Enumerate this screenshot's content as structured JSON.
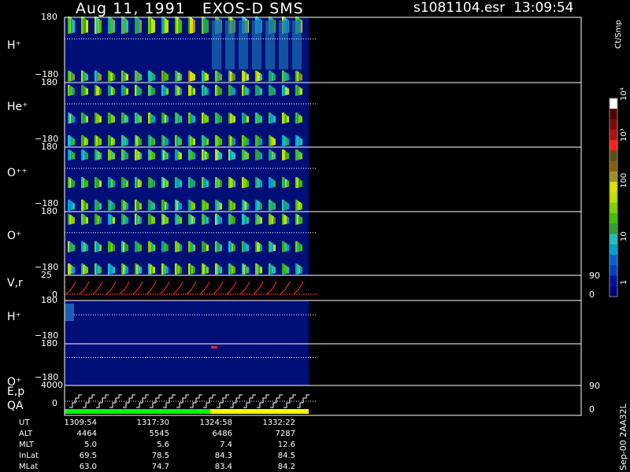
{
  "header": {
    "title": "Aug 11, 1991   EXOS-D SMS",
    "file": "s1081104.esr",
    "time": "13:09:54"
  },
  "colorbar": {
    "unit": "Ct/Smp",
    "tick_labels": [
      "1",
      "10",
      "100",
      "10³",
      "10⁴"
    ],
    "colors": [
      "#000080",
      "#0010a0",
      "#0040c0",
      "#0060d0",
      "#00a0d0",
      "#20c0c0",
      "#30a030",
      "#40c000",
      "#80d000",
      "#c0e000",
      "#e0e000",
      "#a09020",
      "#806010",
      "#605010",
      "#ff2020",
      "#b01010",
      "#800808",
      "#500404",
      "#ffffff"
    ]
  },
  "panels": [
    {
      "label": "H⁺",
      "tick_top": "180",
      "tick_bottom": "−180"
    },
    {
      "label": "He⁺",
      "tick_top": "180",
      "tick_bottom": "−180"
    },
    {
      "label": "O⁺⁺",
      "tick_top": "180",
      "tick_bottom": "−180"
    },
    {
      "label": "O⁺",
      "tick_top": "180",
      "tick_bottom": "−180"
    },
    {
      "label": "V,r",
      "tick_top": "25",
      "tick_mid": "0",
      "right_top": "90",
      "right_bottom": "0"
    },
    {
      "label": "H⁺",
      "tick_top": "180",
      "tick_bottom": "−180"
    },
    {
      "label": "O⁺",
      "tick_top": "180",
      "tick_bottom": "−180"
    },
    {
      "label": "E,p",
      "label2": "QA",
      "tick_top": "4000",
      "tick_mid": "0",
      "right_top": "90",
      "right_bottom": "0"
    }
  ],
  "ephemeris": {
    "rows": [
      {
        "name": "UT",
        "values": [
          "1309:54",
          "1317:30",
          "1324:58",
          "1332:22"
        ]
      },
      {
        "name": "ALT",
        "values": [
          "4464",
          "5545",
          "6486",
          "7287"
        ]
      },
      {
        "name": "MLT",
        "values": [
          "5.0",
          "5.6",
          "7.4",
          "12.6"
        ]
      },
      {
        "name": "InLat",
        "values": [
          "69.5",
          "78.5",
          "84.3",
          "84.5"
        ]
      },
      {
        "name": "MLat",
        "values": [
          "63.0",
          "74.7",
          "83.4",
          "84.2"
        ]
      }
    ]
  },
  "stamp": "Sep-00 2AA32L",
  "chart_data": {
    "type": "heatmap",
    "x_label": "UT",
    "x_ticks": [
      "1309:54",
      "1317:30",
      "1324:58",
      "1332:22"
    ],
    "spectrogram_panels": [
      "H⁺",
      "He⁺",
      "O⁺⁺",
      "O⁺",
      "H⁺",
      "O⁺"
    ],
    "y_range_pitch": [
      -180,
      180
    ],
    "vr_panel": {
      "y_range": [
        0,
        25
      ],
      "right_range": [
        0,
        90
      ],
      "sweep_count": 18
    },
    "ep_panel": {
      "y_range": [
        0,
        4000
      ],
      "right_range": [
        0,
        90
      ],
      "sweep_count": 18
    },
    "qa_bar_colors": [
      "#00ff00",
      "#ffff00"
    ],
    "pulse_count": 18,
    "colorbar_scale": "log",
    "colorbar_range": [
      1,
      10000
    ]
  }
}
